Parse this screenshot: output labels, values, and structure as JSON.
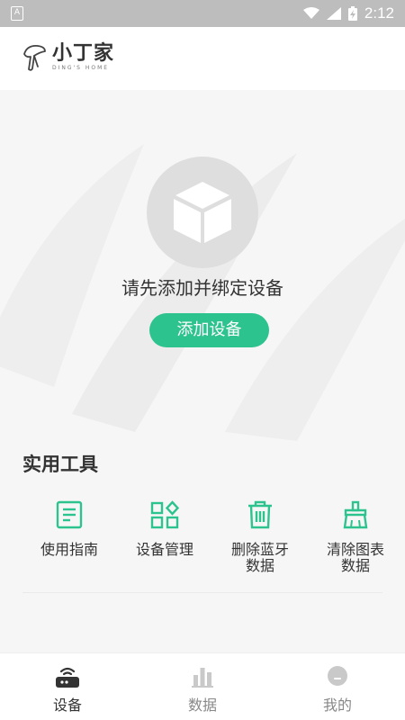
{
  "status_bar": {
    "left_badge": "A",
    "time": "2:12",
    "icons": [
      "wifi-icon",
      "signal-icon",
      "battery-charging-icon"
    ]
  },
  "header": {
    "logo_title": "小丁家",
    "logo_subtitle": "DING'S HOME"
  },
  "main": {
    "empty_prompt": "请先添加并绑定设备",
    "add_button_label": "添加设备",
    "placeholder_icon": "cube-icon"
  },
  "tools": {
    "title": "实用工具",
    "items": [
      {
        "label": "使用指南",
        "icon": "guide-icon"
      },
      {
        "label": "设备管理",
        "icon": "grid-apps-icon"
      },
      {
        "label": "删除蓝牙数据",
        "icon": "trash-icon"
      },
      {
        "label": "清除图表数据",
        "icon": "broom-icon"
      }
    ]
  },
  "tabbar": {
    "tabs": [
      {
        "label": "设备",
        "icon": "router-icon",
        "active": true
      },
      {
        "label": "数据",
        "icon": "bar-chart-icon",
        "active": false
      },
      {
        "label": "我的",
        "icon": "profile-icon",
        "active": false
      }
    ]
  },
  "colors": {
    "accent": "#2dc38e",
    "status_bar": "#bdbdbd",
    "background": "#f6f6f6",
    "text": "#333333",
    "inactive": "#cccccc"
  }
}
